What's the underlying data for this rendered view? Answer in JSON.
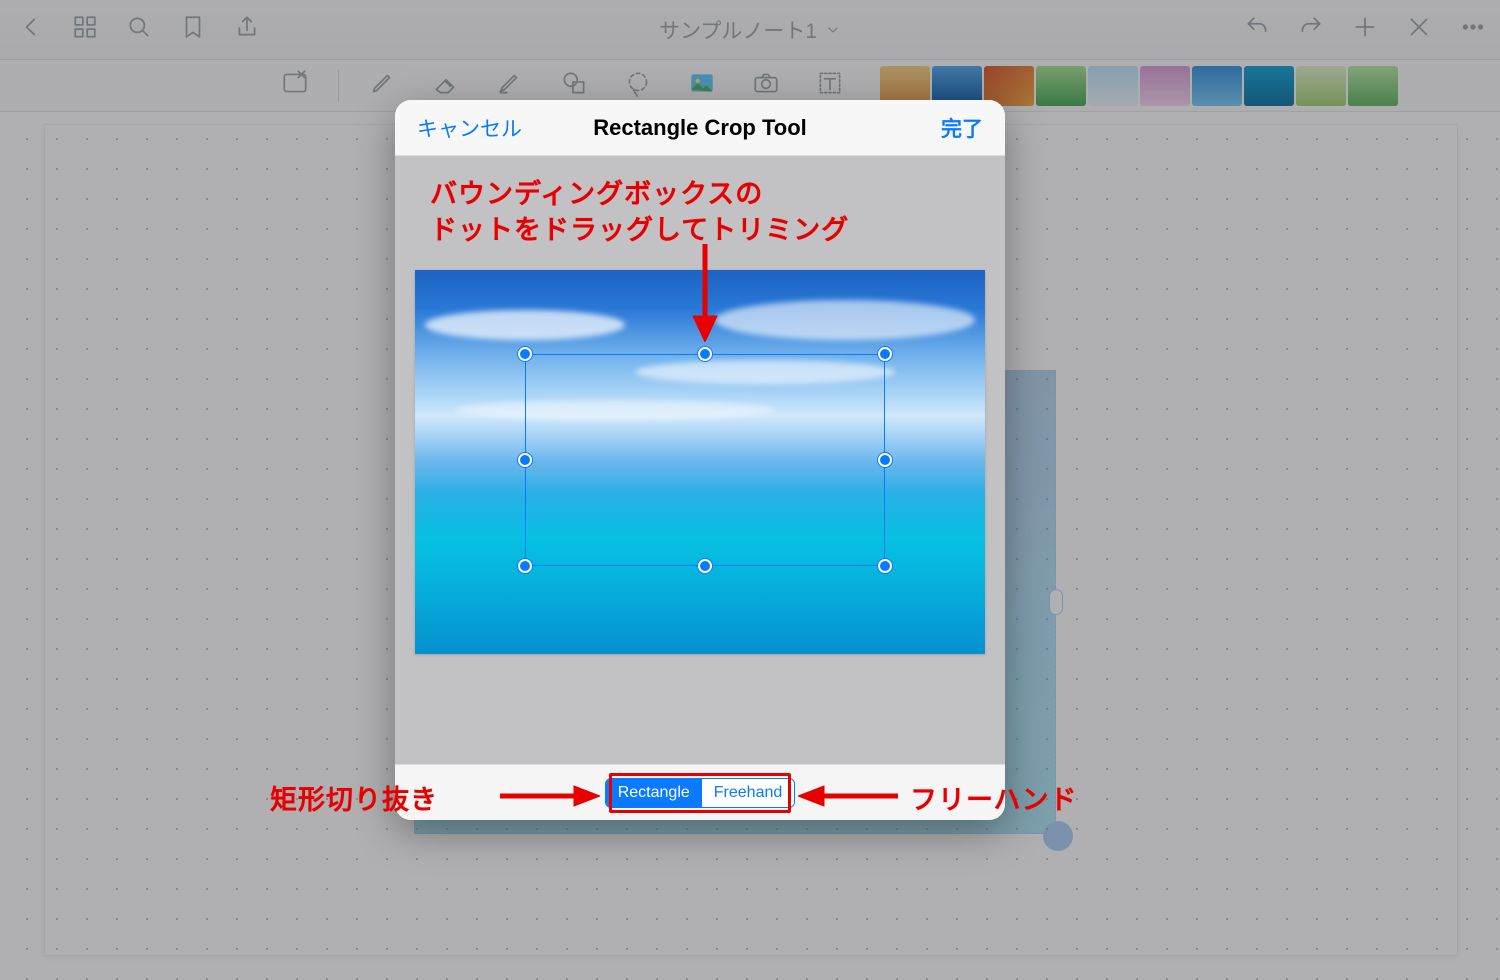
{
  "header": {
    "title": "サンプルノート1"
  },
  "modal": {
    "cancel": "キャンセル",
    "title": "Rectangle Crop Tool",
    "done": "完了",
    "seg_rect": "Rectangle",
    "seg_free": "Freehand"
  },
  "annotations": {
    "top1": "バウンディングボックスの",
    "top2": "ドットをドラッグしてトリミング",
    "left": "矩形切り抜き",
    "right": "フリーハンド"
  },
  "thumb_colors": [
    "linear-gradient(180deg,#f3d07a,#e8974a)",
    "linear-gradient(180deg,#4aa3e8,#0b5aa8)",
    "linear-gradient(135deg,#d94f22,#f2a13a)",
    "linear-gradient(180deg,#a6e08d,#3fa64f)",
    "linear-gradient(180deg,#bde3f8,#e8f3fb)",
    "linear-gradient(180deg,#d59bd2,#f4d2ef)",
    "linear-gradient(180deg,#2f8fe0,#74c9f4)",
    "linear-gradient(180deg,#0aa0d4,#046e9c)",
    "linear-gradient(180deg,#dff1ca,#9fd06a)",
    "linear-gradient(180deg,#b7e7a2,#5ab25a)"
  ]
}
